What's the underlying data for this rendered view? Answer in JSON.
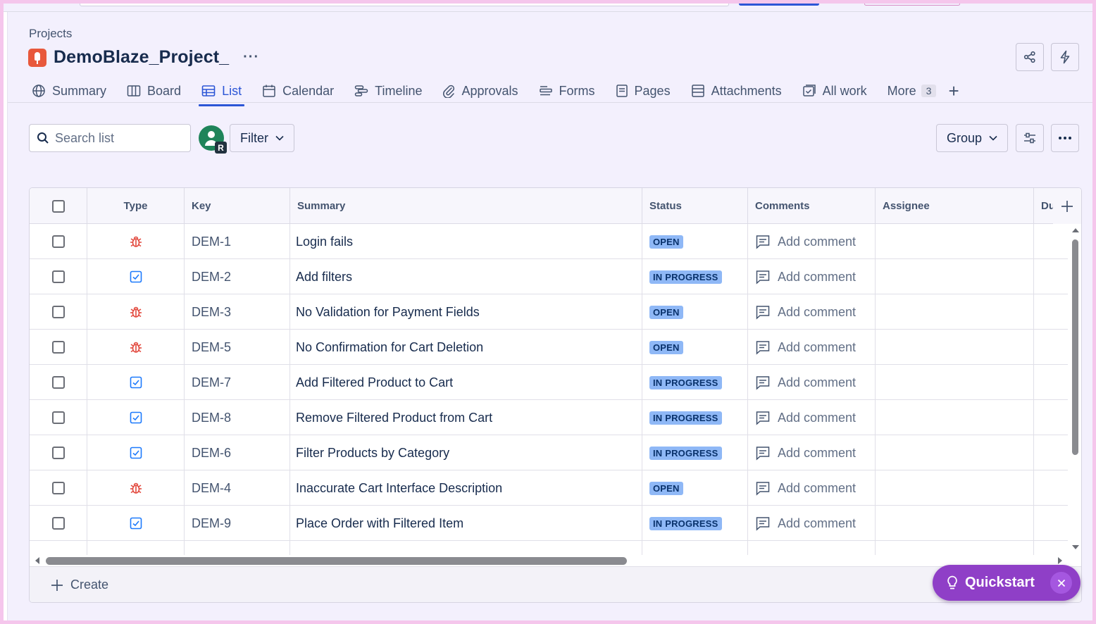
{
  "breadcrumb": "Projects",
  "project": {
    "title": "DemoBlaze_Project_",
    "more": "···"
  },
  "tabs": [
    {
      "label": "Summary",
      "icon": "globe-icon"
    },
    {
      "label": "Board",
      "icon": "board-icon"
    },
    {
      "label": "List",
      "icon": "list-icon",
      "active": true
    },
    {
      "label": "Calendar",
      "icon": "calendar-icon"
    },
    {
      "label": "Timeline",
      "icon": "timeline-icon"
    },
    {
      "label": "Approvals",
      "icon": "paperclip-icon"
    },
    {
      "label": "Forms",
      "icon": "forms-icon"
    },
    {
      "label": "Pages",
      "icon": "pages-icon"
    },
    {
      "label": "Attachments",
      "icon": "attachments-icon"
    },
    {
      "label": "All work",
      "icon": "all-work-icon"
    },
    {
      "label": "More",
      "badge": "3"
    }
  ],
  "toolbar": {
    "search_placeholder": "Search list",
    "avatar_initial": "R",
    "filter_label": "Filter",
    "group_label": "Group"
  },
  "table": {
    "columns": [
      "Type",
      "Key",
      "Summary",
      "Status",
      "Comments",
      "Assignee",
      "Du"
    ],
    "comment_label": "Add comment",
    "rows": [
      {
        "type": "bug",
        "key": "DEM-1",
        "summary": "Login fails",
        "status": "OPEN"
      },
      {
        "type": "task",
        "key": "DEM-2",
        "summary": "Add filters",
        "status": "IN PROGRESS"
      },
      {
        "type": "bug",
        "key": "DEM-3",
        "summary": "No Validation for Payment Fields",
        "status": "OPEN"
      },
      {
        "type": "bug",
        "key": "DEM-5",
        "summary": "No Confirmation for Cart Deletion",
        "status": "OPEN"
      },
      {
        "type": "task",
        "key": "DEM-7",
        "summary": "Add Filtered Product to Cart",
        "status": "IN PROGRESS"
      },
      {
        "type": "task",
        "key": "DEM-8",
        "summary": "Remove Filtered Product from Cart",
        "status": "IN PROGRESS"
      },
      {
        "type": "task",
        "key": "DEM-6",
        "summary": "Filter Products by Category",
        "status": "IN PROGRESS"
      },
      {
        "type": "bug",
        "key": "DEM-4",
        "summary": "Inaccurate Cart Interface Description",
        "status": "OPEN"
      },
      {
        "type": "task",
        "key": "DEM-9",
        "summary": "Place Order with Filtered Item",
        "status": "IN PROGRESS"
      }
    ],
    "create_label": "Create"
  },
  "quickstart": {
    "label": "Quickstart"
  },
  "colors": {
    "accent": "#2c56d6",
    "bug": "#e2483d",
    "task": "#1d7afc",
    "lozenge": "#8fb8f6",
    "quickstart": "#8f3fc7"
  }
}
